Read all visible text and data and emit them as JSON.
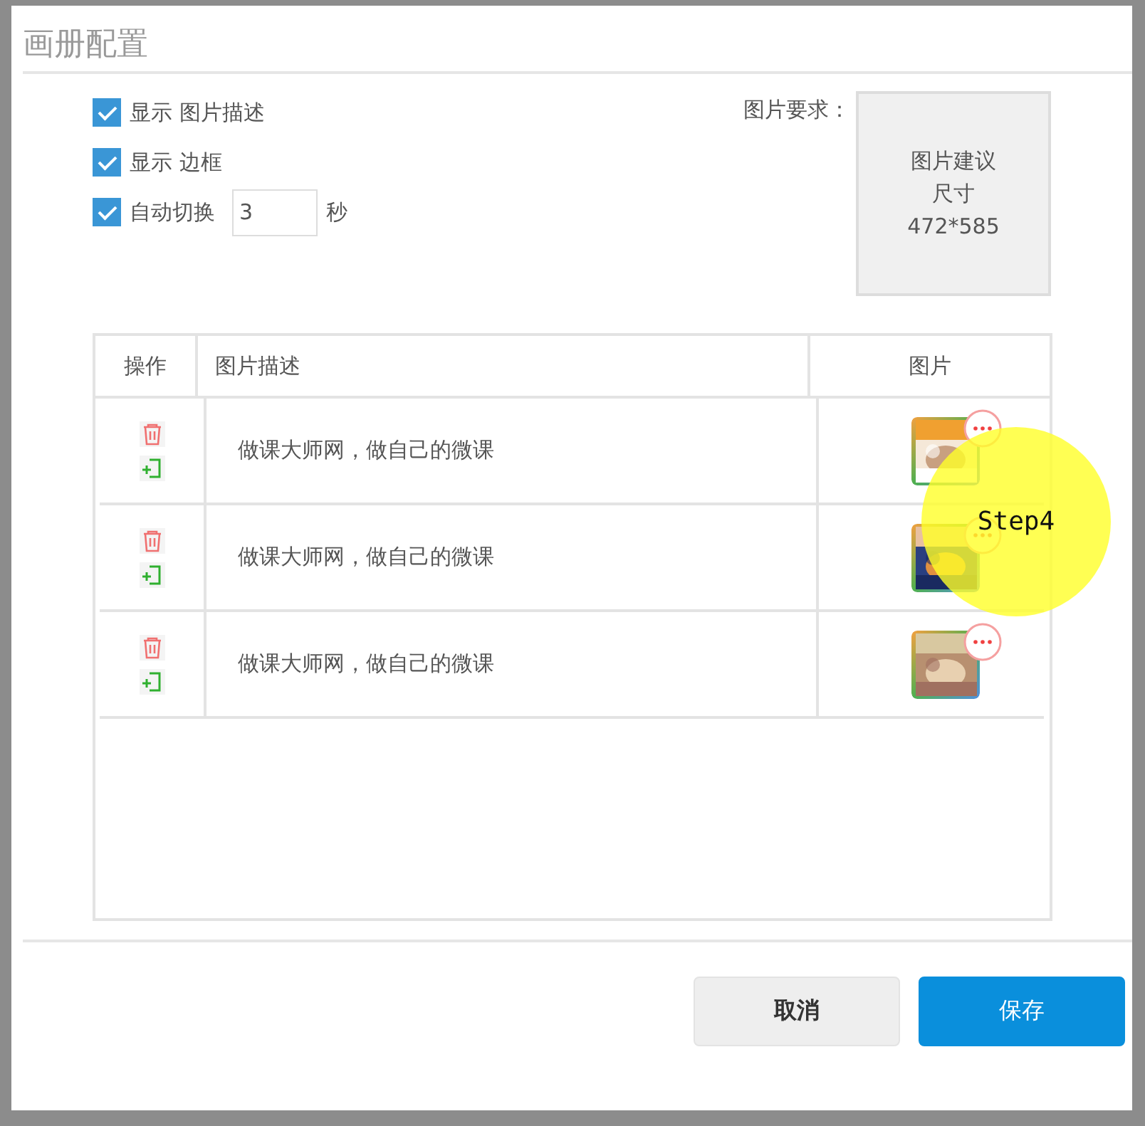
{
  "dialog": {
    "title": "画册配置"
  },
  "options": [
    {
      "label": "显示 图片描述",
      "checked": true
    },
    {
      "label": "显示 边框",
      "checked": true
    },
    {
      "label": "自动切换",
      "checked": true,
      "value": "3",
      "unit": "秒"
    }
  ],
  "image_requirement": {
    "label": "图片要求：",
    "lines": [
      "图片建议",
      "尺寸",
      "472*585"
    ]
  },
  "table": {
    "columns": [
      "操作",
      "图片描述",
      "图片"
    ],
    "rows": [
      {
        "description": "做课大师网，做自己的微课"
      },
      {
        "description": "做课大师网，做自己的微课"
      },
      {
        "description": "做课大师网，做自己的微课"
      }
    ]
  },
  "buttons": [
    {
      "label": "取消",
      "kind": "secondary"
    },
    {
      "label": "保存",
      "kind": "primary"
    }
  ],
  "annotation": {
    "text": "Step4"
  }
}
